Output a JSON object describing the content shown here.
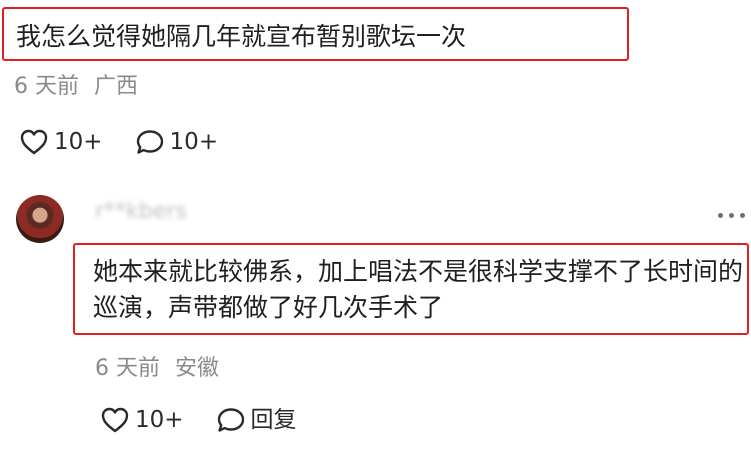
{
  "comment1": {
    "text": "我怎么觉得她隔几年就宣布暂别歌坛一次",
    "time": "6 天前",
    "location": "广西",
    "like_count": "10+",
    "reply_count": "10+"
  },
  "comment2": {
    "username": "r**kbers",
    "text": "她本来就比较佛系，加上唱法不是很科学支撑不了长时间的巡演，声带都做了好几次手术了",
    "time": "6 天前",
    "location": "安徽",
    "like_count": "10+",
    "reply_label": "回复"
  },
  "icons": {
    "like": "heart-outline-icon",
    "comment": "speech-bubble-icon",
    "more": "more-dots-icon"
  },
  "colors": {
    "highlight_border": "#e02020",
    "meta_text": "#8a8a8a"
  }
}
